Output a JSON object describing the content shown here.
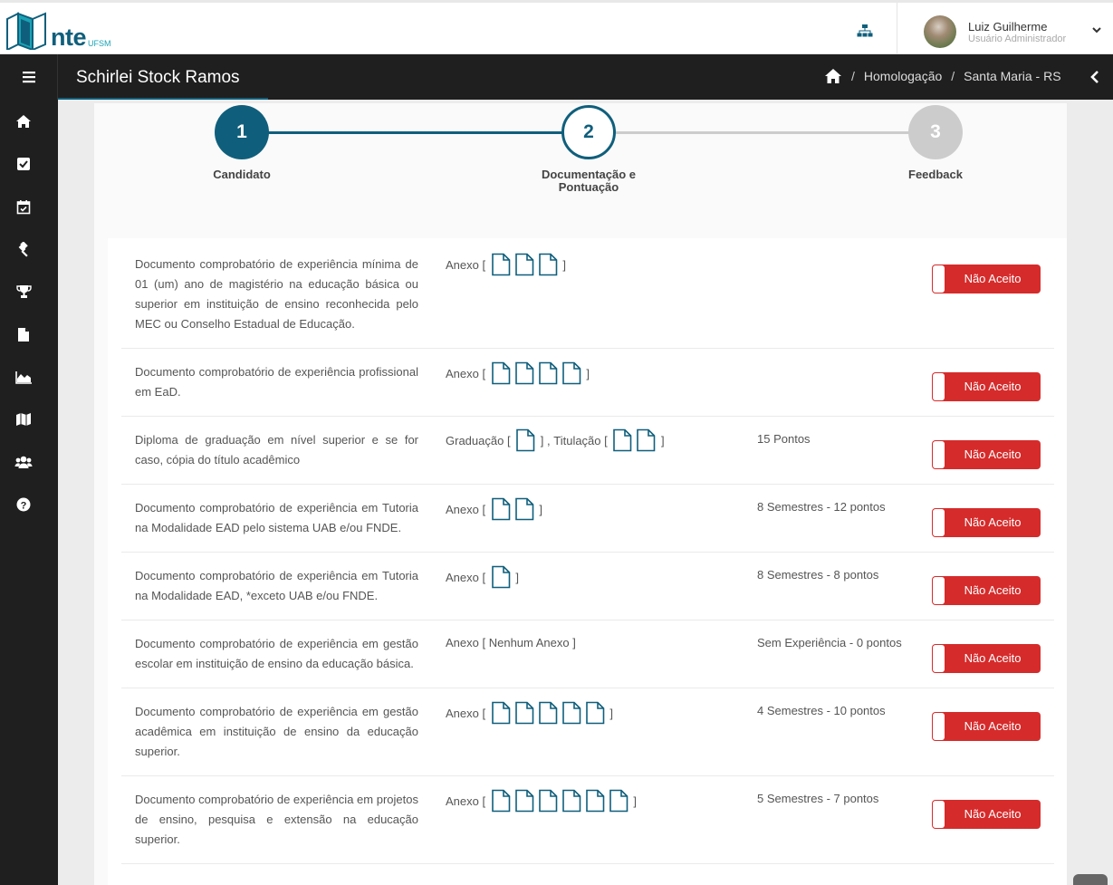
{
  "header": {
    "logo_text": "nte",
    "logo_sub": "UFSM",
    "user_name": "Luiz Guilherme",
    "user_role": "Usuário Administrador"
  },
  "titlebar": {
    "title": "Schirlei Stock Ramos",
    "breadcrumb": [
      "Homologação",
      "Santa Maria - RS"
    ]
  },
  "sidebar": {
    "items": [
      "home-icon",
      "checkbox-icon",
      "calendar-check-icon",
      "gavel-icon",
      "trophy-icon",
      "file-icon",
      "area-chart-icon",
      "map-icon",
      "users-icon",
      "help-icon"
    ]
  },
  "stepper": {
    "steps": [
      {
        "number": "1",
        "label": "Candidato",
        "state": "done"
      },
      {
        "number": "2",
        "label": "Documentação e Pontuação",
        "state": "current"
      },
      {
        "number": "3",
        "label": "Feedback",
        "state": "pending"
      }
    ]
  },
  "rows": [
    {
      "desc": "Documento comprobatório de experiência mínima de 01 (um) ano de magistério na educação básica ou superior em instituição de ensino reconhecida pelo MEC ou Conselho Estadual de Educação.",
      "groups": [
        {
          "label": "Anexo",
          "files": 3
        }
      ],
      "pontos": "",
      "button": "Não Aceito"
    },
    {
      "desc": "Documento comprobatório de experiência profissional em EaD.",
      "groups": [
        {
          "label": "Anexo",
          "files": 4
        }
      ],
      "pontos": "",
      "button": "Não Aceito"
    },
    {
      "desc": "Diploma de graduação em nível superior e se for caso, cópia do título acadêmico",
      "groups": [
        {
          "label": "Graduação",
          "files": 1
        },
        {
          "label": "Titulação",
          "files": 2
        }
      ],
      "pontos": "15 Pontos",
      "button": "Não Aceito"
    },
    {
      "desc": "Documento comprobatório de experiência em Tutoria na Modalidade EAD pelo sistema UAB e/ou FNDE.",
      "groups": [
        {
          "label": "Anexo",
          "files": 2
        }
      ],
      "pontos": "8 Semestres - 12 pontos",
      "button": "Não Aceito"
    },
    {
      "desc": "Documento comprobatório de experiência em Tutoria na Modalidade EAD, *exceto UAB e/ou FNDE.",
      "groups": [
        {
          "label": "Anexo",
          "files": 1
        }
      ],
      "pontos": "8 Semestres - 8 pontos",
      "button": "Não Aceito"
    },
    {
      "desc": "Documento comprobatório de experiência em gestão escolar em instituição de ensino da educação básica.",
      "groups": [
        {
          "label": "Anexo",
          "files": 0,
          "empty_text": "Nenhum Anexo"
        }
      ],
      "pontos": "Sem Experiência - 0 pontos",
      "button": "Não Aceito"
    },
    {
      "desc": "Documento comprobatório de experiência em gestão acadêmica em instituição de ensino da educação superior.",
      "groups": [
        {
          "label": "Anexo",
          "files": 5
        }
      ],
      "pontos": "4 Semestres - 10 pontos",
      "button": "Não Aceito"
    },
    {
      "desc": "Documento comprobatório de experiência em projetos de ensino, pesquisa e extensão na educação superior.",
      "groups": [
        {
          "label": "Anexo",
          "files": 6
        }
      ],
      "pontos": "5 Semestres - 7 pontos",
      "button": "Não Aceito"
    }
  ],
  "colors": {
    "primary": "#0f5f7c",
    "danger": "#d62b2b",
    "sidebar": "#1f1f1f",
    "step_pending": "#cccccc"
  }
}
